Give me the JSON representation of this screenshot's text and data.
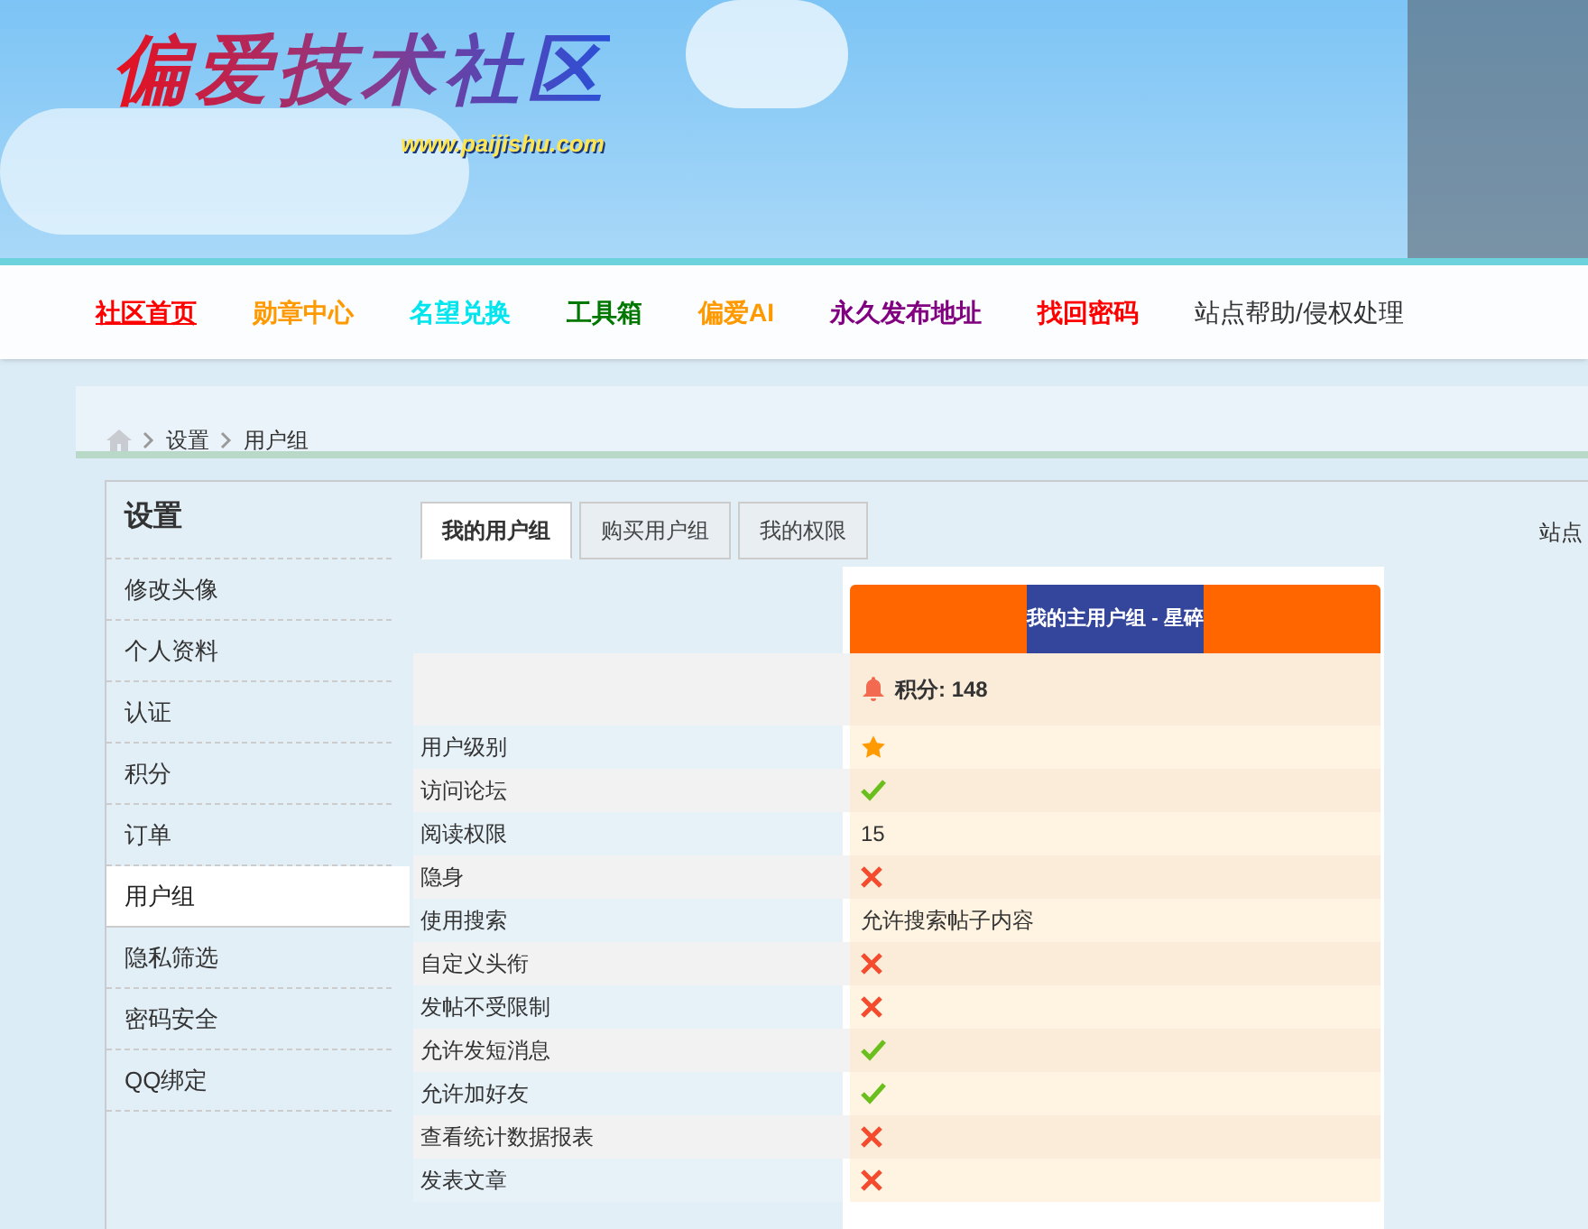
{
  "logo": {
    "title": "偏爱技术社区",
    "url": "www.paijishu.com"
  },
  "nav": [
    {
      "label": "社区首页",
      "color": "#ff0000",
      "selected": true
    },
    {
      "label": "勋章中心",
      "color": "#ff9900",
      "selected": false
    },
    {
      "label": "名望兑换",
      "color": "#00e5ee",
      "selected": false
    },
    {
      "label": "工具箱",
      "color": "#007700",
      "selected": false
    },
    {
      "label": "偏爱AI",
      "color": "#ff9900",
      "selected": false
    },
    {
      "label": "永久发布地址",
      "color": "#800080",
      "selected": false
    },
    {
      "label": "找回密码",
      "color": "#ff0000",
      "selected": false
    },
    {
      "label": "站点帮助/侵权处理",
      "color": "#333333",
      "selected": false
    }
  ],
  "breadcrumb": [
    "设置",
    "用户组"
  ],
  "sidebar": {
    "title": "设置",
    "items": [
      {
        "label": "修改头像",
        "selected": false
      },
      {
        "label": "个人资料",
        "selected": false
      },
      {
        "label": "认证",
        "selected": false
      },
      {
        "label": "积分",
        "selected": false
      },
      {
        "label": "订单",
        "selected": false
      },
      {
        "label": "用户组",
        "selected": true
      },
      {
        "label": "隐私筛选",
        "selected": false
      },
      {
        "label": "密码安全",
        "selected": false
      },
      {
        "label": "QQ绑定",
        "selected": false
      }
    ]
  },
  "tabs": [
    {
      "label": "我的用户组",
      "selected": true
    },
    {
      "label": "购买用户组",
      "selected": false
    },
    {
      "label": "我的权限",
      "selected": false
    }
  ],
  "side_note": "站点",
  "group": {
    "title": "我的主用户组 - 星碎",
    "points": "积分: 148"
  },
  "rows": [
    {
      "label": "用户级别",
      "kind": "star"
    },
    {
      "label": "访问论坛",
      "kind": "yes"
    },
    {
      "label": "阅读权限",
      "kind": "text",
      "value": "15"
    },
    {
      "label": "隐身",
      "kind": "no"
    },
    {
      "label": "使用搜索",
      "kind": "text",
      "value": "允许搜索帖子内容"
    },
    {
      "label": "自定义头衔",
      "kind": "no"
    },
    {
      "label": "发帖不受限制",
      "kind": "no"
    },
    {
      "label": "允许发短消息",
      "kind": "yes"
    },
    {
      "label": "允许加好友",
      "kind": "yes"
    },
    {
      "label": "查看统计数据报表",
      "kind": "no"
    },
    {
      "label": "发表文章",
      "kind": "no"
    }
  ]
}
